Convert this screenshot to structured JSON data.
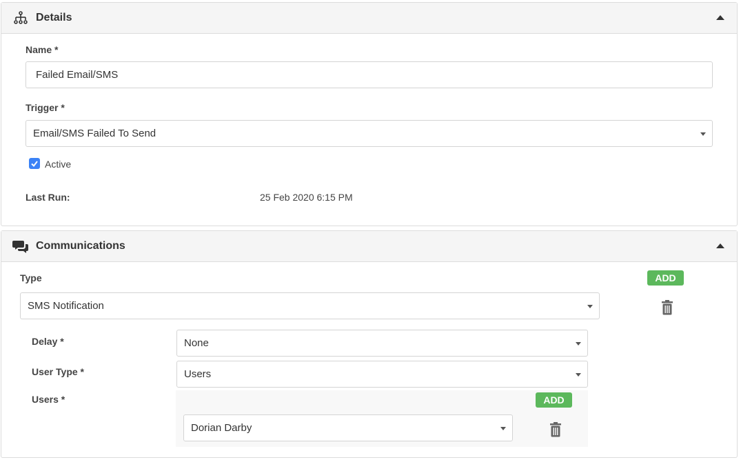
{
  "details": {
    "title": "Details",
    "name_label": "Name *",
    "name_value": "Failed Email/SMS",
    "trigger_label": "Trigger *",
    "trigger_value": "Email/SMS Failed To Send",
    "active_label": "Active",
    "active_checked": true,
    "last_run_label": "Last Run:",
    "last_run_value": "25 Feb 2020 6:15 PM"
  },
  "communications": {
    "title": "Communications",
    "type_label": "Type",
    "add_label": "ADD",
    "type_value": "SMS Notification",
    "delay_label": "Delay *",
    "delay_value": "None",
    "user_type_label": "User Type *",
    "user_type_value": "Users",
    "users_label": "Users *",
    "users_add_label": "ADD",
    "user_value": "Dorian Darby"
  },
  "colors": {
    "add_button": "#5cb85c",
    "checkbox": "#3b82f6",
    "header_bg": "#f5f5f5"
  }
}
